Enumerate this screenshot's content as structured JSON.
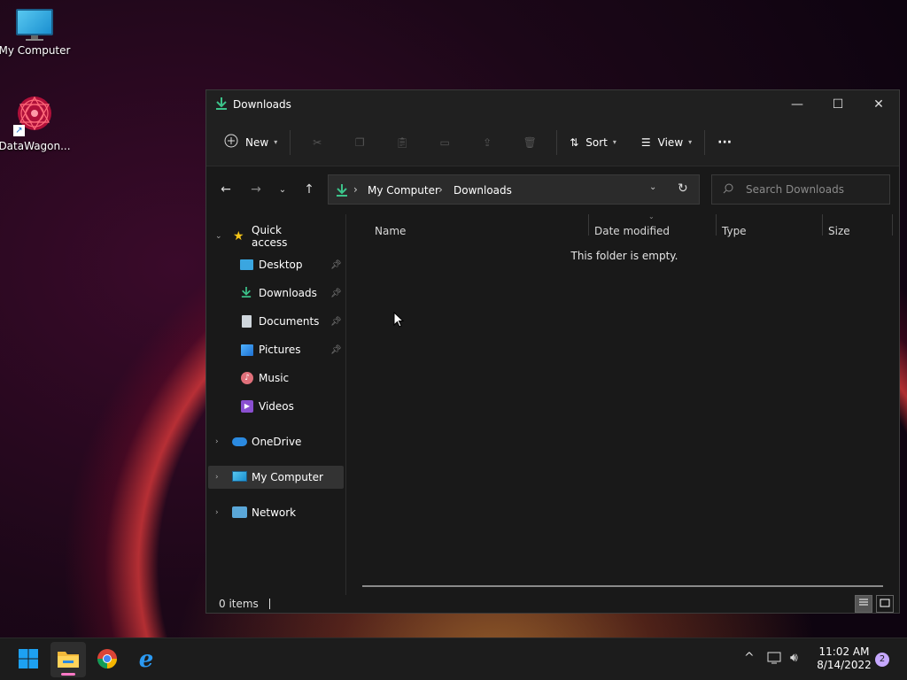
{
  "desktop": {
    "icons": [
      {
        "label": "My Computer",
        "icon": "monitor-icon"
      },
      {
        "label": "DataWagon...",
        "icon": "datawagon-logo-icon"
      }
    ]
  },
  "window": {
    "title": "Downloads",
    "controls": {
      "minimize": "—",
      "maximize": "☐",
      "close": "✕"
    },
    "toolbar": {
      "new_label": "New",
      "sort_label": "Sort",
      "view_label": "View",
      "more_label": "···"
    },
    "address": {
      "segments": [
        "My Computer",
        "Downloads"
      ]
    },
    "search": {
      "placeholder": "Search Downloads"
    },
    "sidebar": {
      "quick_access": "Quick access",
      "items": [
        {
          "label": "Desktop",
          "icon": "desktop-folder-icon",
          "pinned": true
        },
        {
          "label": "Downloads",
          "icon": "download-icon",
          "pinned": true
        },
        {
          "label": "Documents",
          "icon": "documents-icon",
          "pinned": true
        },
        {
          "label": "Pictures",
          "icon": "pictures-icon",
          "pinned": true
        },
        {
          "label": "Music",
          "icon": "music-icon",
          "pinned": false
        },
        {
          "label": "Videos",
          "icon": "videos-icon",
          "pinned": false
        }
      ],
      "onedrive": "OneDrive",
      "my_computer": "My Computer",
      "network": "Network"
    },
    "columns": [
      "Name",
      "Date modified",
      "Type",
      "Size"
    ],
    "empty_message": "This folder is empty.",
    "status": {
      "items_count": "0 items"
    }
  },
  "taskbar": {
    "apps": [
      {
        "name": "start",
        "icon": "windows-start-icon"
      },
      {
        "name": "file-explorer",
        "icon": "folder-icon",
        "active": true
      },
      {
        "name": "chrome",
        "icon": "chrome-icon"
      },
      {
        "name": "internet-explorer",
        "icon": "internet-explorer-icon"
      }
    ],
    "clock": {
      "time": "11:02 AM",
      "date": "8/14/2022"
    },
    "notification_count": "2"
  },
  "colors": {
    "accent_green": "#3cc38a",
    "window_bg": "#191919",
    "titlebar_bg": "#202020",
    "taskbar_bg": "#1c1c1c"
  }
}
